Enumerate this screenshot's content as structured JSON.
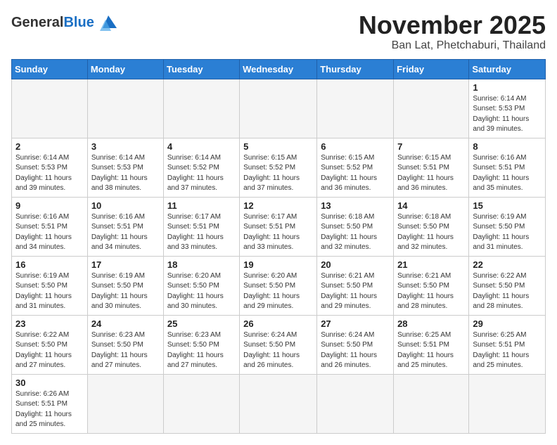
{
  "header": {
    "logo_general": "General",
    "logo_blue": "Blue",
    "month_title": "November 2025",
    "location": "Ban Lat, Phetchaburi, Thailand"
  },
  "weekdays": [
    "Sunday",
    "Monday",
    "Tuesday",
    "Wednesday",
    "Thursday",
    "Friday",
    "Saturday"
  ],
  "weeks": [
    [
      {
        "day": "",
        "info": ""
      },
      {
        "day": "",
        "info": ""
      },
      {
        "day": "",
        "info": ""
      },
      {
        "day": "",
        "info": ""
      },
      {
        "day": "",
        "info": ""
      },
      {
        "day": "",
        "info": ""
      },
      {
        "day": "1",
        "info": "Sunrise: 6:14 AM\nSunset: 5:53 PM\nDaylight: 11 hours\nand 39 minutes."
      }
    ],
    [
      {
        "day": "2",
        "info": "Sunrise: 6:14 AM\nSunset: 5:53 PM\nDaylight: 11 hours\nand 39 minutes."
      },
      {
        "day": "3",
        "info": "Sunrise: 6:14 AM\nSunset: 5:53 PM\nDaylight: 11 hours\nand 38 minutes."
      },
      {
        "day": "4",
        "info": "Sunrise: 6:14 AM\nSunset: 5:52 PM\nDaylight: 11 hours\nand 37 minutes."
      },
      {
        "day": "5",
        "info": "Sunrise: 6:15 AM\nSunset: 5:52 PM\nDaylight: 11 hours\nand 37 minutes."
      },
      {
        "day": "6",
        "info": "Sunrise: 6:15 AM\nSunset: 5:52 PM\nDaylight: 11 hours\nand 36 minutes."
      },
      {
        "day": "7",
        "info": "Sunrise: 6:15 AM\nSunset: 5:51 PM\nDaylight: 11 hours\nand 36 minutes."
      },
      {
        "day": "8",
        "info": "Sunrise: 6:16 AM\nSunset: 5:51 PM\nDaylight: 11 hours\nand 35 minutes."
      }
    ],
    [
      {
        "day": "9",
        "info": "Sunrise: 6:16 AM\nSunset: 5:51 PM\nDaylight: 11 hours\nand 34 minutes."
      },
      {
        "day": "10",
        "info": "Sunrise: 6:16 AM\nSunset: 5:51 PM\nDaylight: 11 hours\nand 34 minutes."
      },
      {
        "day": "11",
        "info": "Sunrise: 6:17 AM\nSunset: 5:51 PM\nDaylight: 11 hours\nand 33 minutes."
      },
      {
        "day": "12",
        "info": "Sunrise: 6:17 AM\nSunset: 5:51 PM\nDaylight: 11 hours\nand 33 minutes."
      },
      {
        "day": "13",
        "info": "Sunrise: 6:18 AM\nSunset: 5:50 PM\nDaylight: 11 hours\nand 32 minutes."
      },
      {
        "day": "14",
        "info": "Sunrise: 6:18 AM\nSunset: 5:50 PM\nDaylight: 11 hours\nand 32 minutes."
      },
      {
        "day": "15",
        "info": "Sunrise: 6:19 AM\nSunset: 5:50 PM\nDaylight: 11 hours\nand 31 minutes."
      }
    ],
    [
      {
        "day": "16",
        "info": "Sunrise: 6:19 AM\nSunset: 5:50 PM\nDaylight: 11 hours\nand 31 minutes."
      },
      {
        "day": "17",
        "info": "Sunrise: 6:19 AM\nSunset: 5:50 PM\nDaylight: 11 hours\nand 30 minutes."
      },
      {
        "day": "18",
        "info": "Sunrise: 6:20 AM\nSunset: 5:50 PM\nDaylight: 11 hours\nand 30 minutes."
      },
      {
        "day": "19",
        "info": "Sunrise: 6:20 AM\nSunset: 5:50 PM\nDaylight: 11 hours\nand 29 minutes."
      },
      {
        "day": "20",
        "info": "Sunrise: 6:21 AM\nSunset: 5:50 PM\nDaylight: 11 hours\nand 29 minutes."
      },
      {
        "day": "21",
        "info": "Sunrise: 6:21 AM\nSunset: 5:50 PM\nDaylight: 11 hours\nand 28 minutes."
      },
      {
        "day": "22",
        "info": "Sunrise: 6:22 AM\nSunset: 5:50 PM\nDaylight: 11 hours\nand 28 minutes."
      }
    ],
    [
      {
        "day": "23",
        "info": "Sunrise: 6:22 AM\nSunset: 5:50 PM\nDaylight: 11 hours\nand 27 minutes."
      },
      {
        "day": "24",
        "info": "Sunrise: 6:23 AM\nSunset: 5:50 PM\nDaylight: 11 hours\nand 27 minutes."
      },
      {
        "day": "25",
        "info": "Sunrise: 6:23 AM\nSunset: 5:50 PM\nDaylight: 11 hours\nand 27 minutes."
      },
      {
        "day": "26",
        "info": "Sunrise: 6:24 AM\nSunset: 5:50 PM\nDaylight: 11 hours\nand 26 minutes."
      },
      {
        "day": "27",
        "info": "Sunrise: 6:24 AM\nSunset: 5:50 PM\nDaylight: 11 hours\nand 26 minutes."
      },
      {
        "day": "28",
        "info": "Sunrise: 6:25 AM\nSunset: 5:51 PM\nDaylight: 11 hours\nand 25 minutes."
      },
      {
        "day": "29",
        "info": "Sunrise: 6:25 AM\nSunset: 5:51 PM\nDaylight: 11 hours\nand 25 minutes."
      }
    ],
    [
      {
        "day": "30",
        "info": "Sunrise: 6:26 AM\nSunset: 5:51 PM\nDaylight: 11 hours\nand 25 minutes."
      },
      {
        "day": "",
        "info": ""
      },
      {
        "day": "",
        "info": ""
      },
      {
        "day": "",
        "info": ""
      },
      {
        "day": "",
        "info": ""
      },
      {
        "day": "",
        "info": ""
      },
      {
        "day": "",
        "info": ""
      }
    ]
  ]
}
